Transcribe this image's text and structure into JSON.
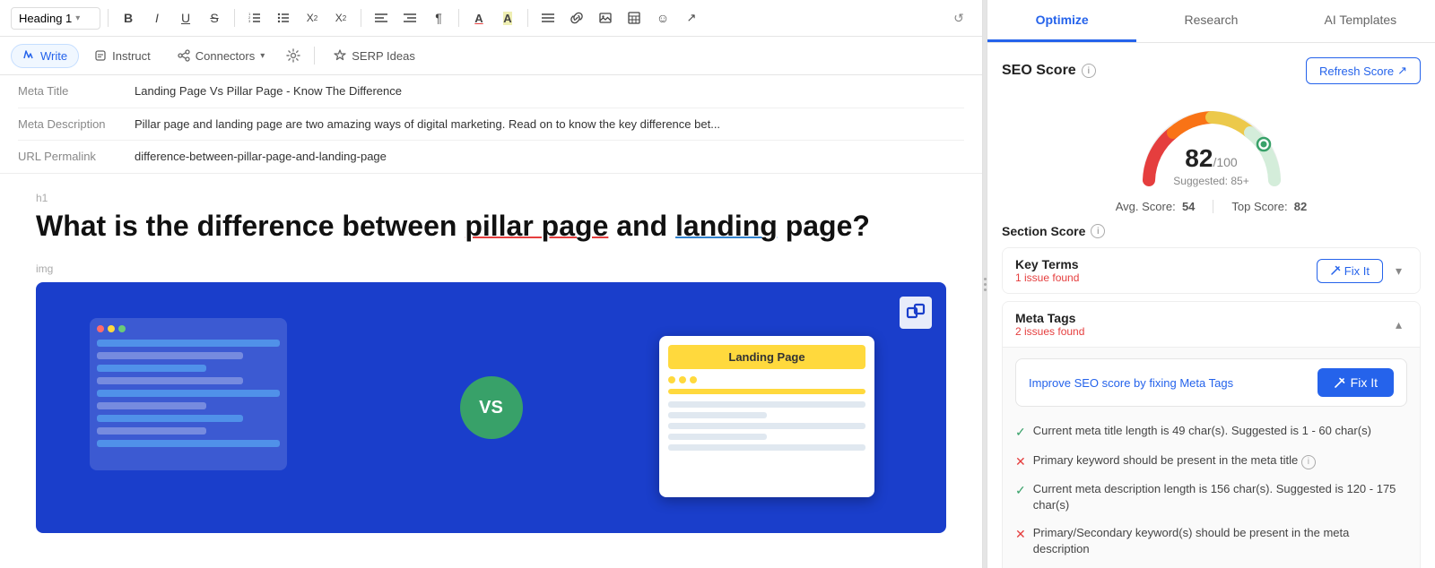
{
  "toolbar": {
    "heading_select": "Heading 1",
    "heading_arrow": "▾",
    "buttons": [
      "B",
      "I",
      "U",
      "S",
      "≡",
      "≣",
      "₂",
      "²",
      "⇤",
      "⇥",
      "¶",
      "A",
      "Ā",
      "≡",
      "🔗",
      "▭",
      "⊞",
      "☺",
      "↗"
    ],
    "history_icon": "↺"
  },
  "toolbar2": {
    "write_label": "Write",
    "instruct_label": "Instruct",
    "connectors_label": "Connectors",
    "gear_label": "⚙",
    "serp_ideas_label": "SERP Ideas"
  },
  "meta": {
    "title_label": "Meta Title",
    "title_value": "Landing Page Vs Pillar Page - Know The Difference",
    "desc_label": "Meta Description",
    "desc_value": "Pillar page and landing page are two amazing ways of digital marketing. Read on to know the key difference bet...",
    "url_label": "URL Permalink",
    "url_value": "difference-between-pillar-page-and-landing-page"
  },
  "article": {
    "h1_label": "h1",
    "title_part1": "What is the difference between ",
    "title_highlight1": "pillar page",
    "title_mid": " and ",
    "title_highlight2": "landing",
    "title_part2": " page?",
    "img_label": "img",
    "image_vs_text": "VS",
    "image_landing_page_label": "Landing Page"
  },
  "right_panel": {
    "tab_optimize": "Optimize",
    "tab_research": "Research",
    "tab_ai_templates": "AI Templates"
  },
  "seo_section": {
    "title": "SEO Score",
    "refresh_btn": "Refresh Score",
    "refresh_icon": "↗",
    "score_value": "82",
    "score_denom": "/100",
    "score_suggested": "Suggested: 85+",
    "avg_label": "Avg. Score:",
    "avg_value": "54",
    "top_label": "Top Score:",
    "top_value": "82"
  },
  "section_score": {
    "title": "Section Score",
    "key_terms": {
      "label": "Key Terms",
      "issues": "1 issue found",
      "fix_btn": "Fix It"
    },
    "meta_tags": {
      "label": "Meta Tags",
      "issues": "2 issues found",
      "fix_btn": "Fix It",
      "improve_text": "Improve SEO score by fixing Meta Tags",
      "improve_btn": "Fix It",
      "checks": [
        {
          "status": "ok",
          "text": "Current meta title length is 49 char(s). Suggested is 1 - 60 char(s)"
        },
        {
          "status": "err",
          "text": "Primary keyword should be present in the meta title"
        },
        {
          "status": "ok",
          "text": "Current meta description length is 156 char(s). Suggested is 120 - 175 char(s)"
        },
        {
          "status": "err",
          "text": "Primary/Secondary keyword(s) should be present in the meta description"
        }
      ]
    }
  }
}
